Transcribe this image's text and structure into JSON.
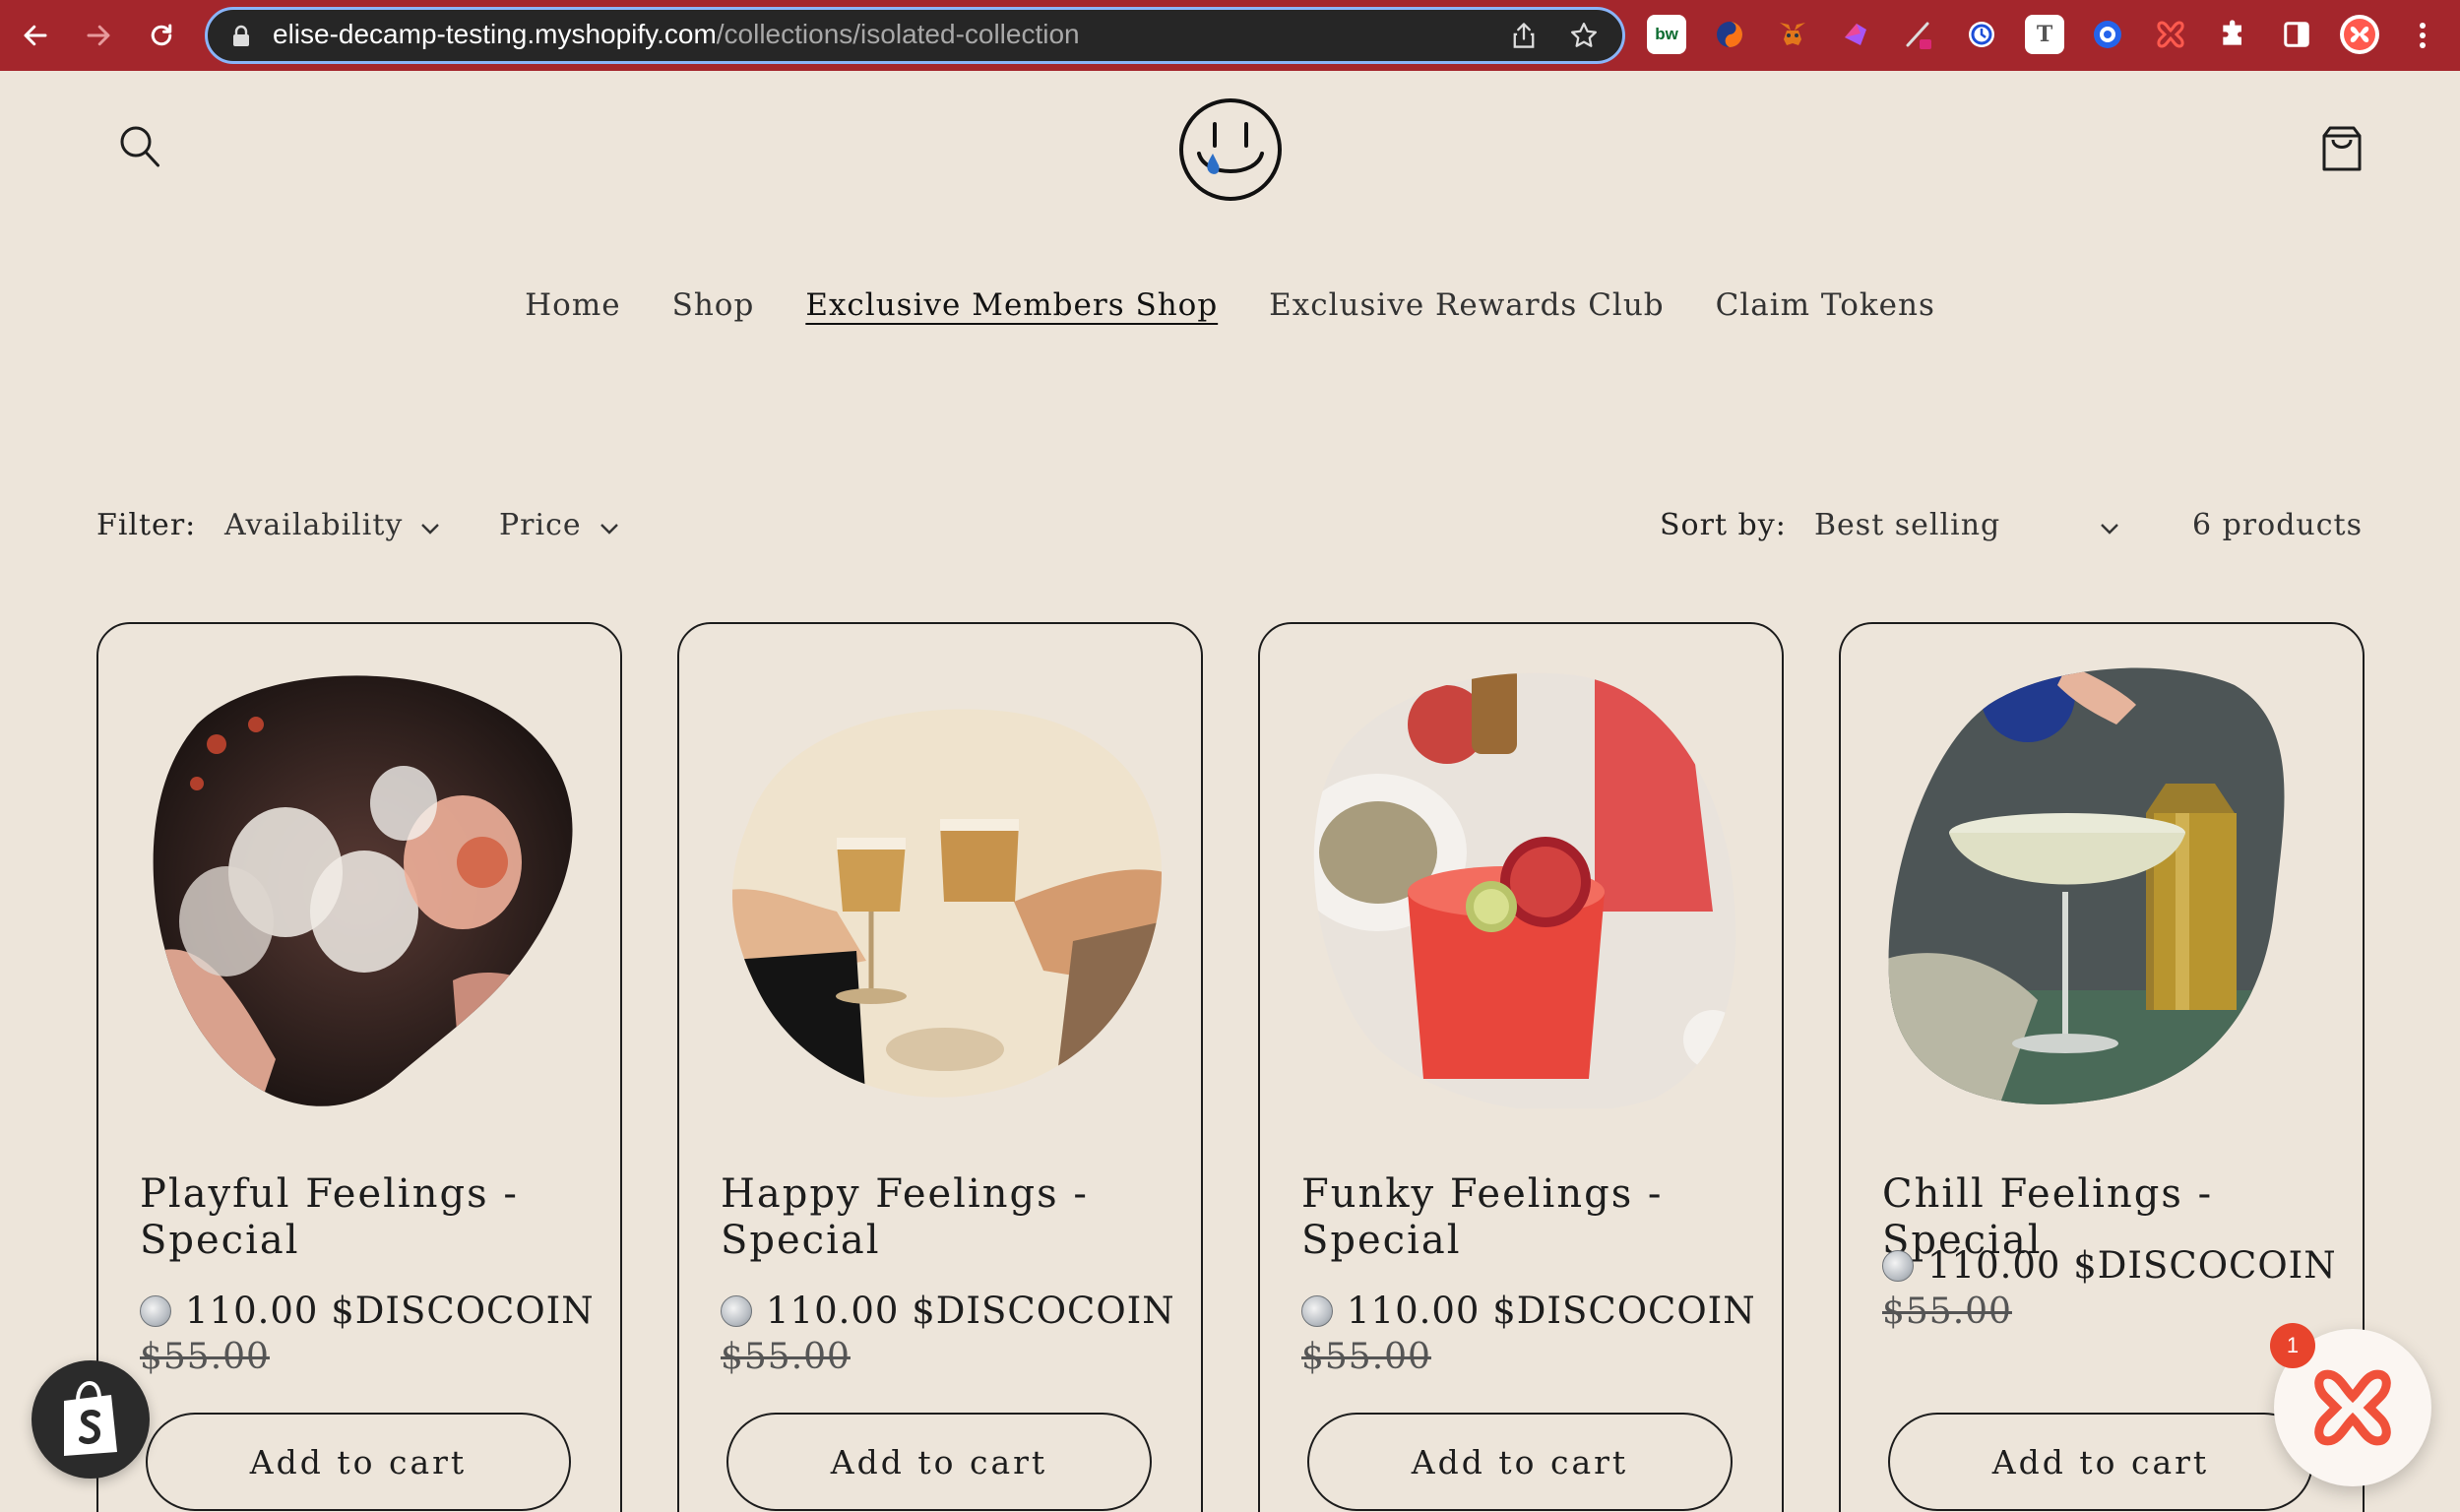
{
  "browser": {
    "url_host": "elise-decamp-testing.myshopify.com",
    "url_path": "/collections/isolated-collection",
    "extensions": [
      "bw-extension-icon",
      "swirl-extension-icon",
      "metamask-fox-icon",
      "gem-extension-icon",
      "pen-extension-icon",
      "clock-extension-icon",
      "t-extension-icon",
      "target-extension-icon",
      "app-x-extension-icon",
      "puzzle-icon",
      "sidebar-icon",
      "profile-icon"
    ],
    "ext_bw_label": "bw",
    "ext_t_label": "T"
  },
  "header": {
    "menu": [
      {
        "label": "Home",
        "active": false
      },
      {
        "label": "Shop",
        "active": false
      },
      {
        "label": "Exclusive Members Shop",
        "active": true
      },
      {
        "label": "Exclusive Rewards Club",
        "active": false
      },
      {
        "label": "Claim Tokens",
        "active": false
      }
    ]
  },
  "facets": {
    "filter_label": "Filter:",
    "availability": "Availability",
    "price": "Price",
    "sort_label": "Sort by:",
    "sort_value": "Best selling",
    "count": "6 products"
  },
  "products": [
    {
      "title": "Playful Feelings - Special",
      "price": "110.00 $DISCOCOIN",
      "compare": "$55.00",
      "cta": "Add to cart"
    },
    {
      "title": "Happy Feelings - Special",
      "price": "110.00 $DISCOCOIN",
      "compare": "$55.00",
      "cta": "Add to cart"
    },
    {
      "title": "Funky Feelings - Special",
      "price": "110.00 $DISCOCOIN",
      "compare": "$55.00",
      "cta": "Add to cart"
    },
    {
      "title": "Chill Feelings - Special",
      "price": "110.00 $DISCOCOIN",
      "compare": "$55.00",
      "cta": "Add to cart"
    }
  ],
  "widgets": {
    "notification_count": "1"
  },
  "colors": {
    "chrome": "#A4262C",
    "page_bg": "#EDE5DA",
    "accent": "#E8442C"
  }
}
